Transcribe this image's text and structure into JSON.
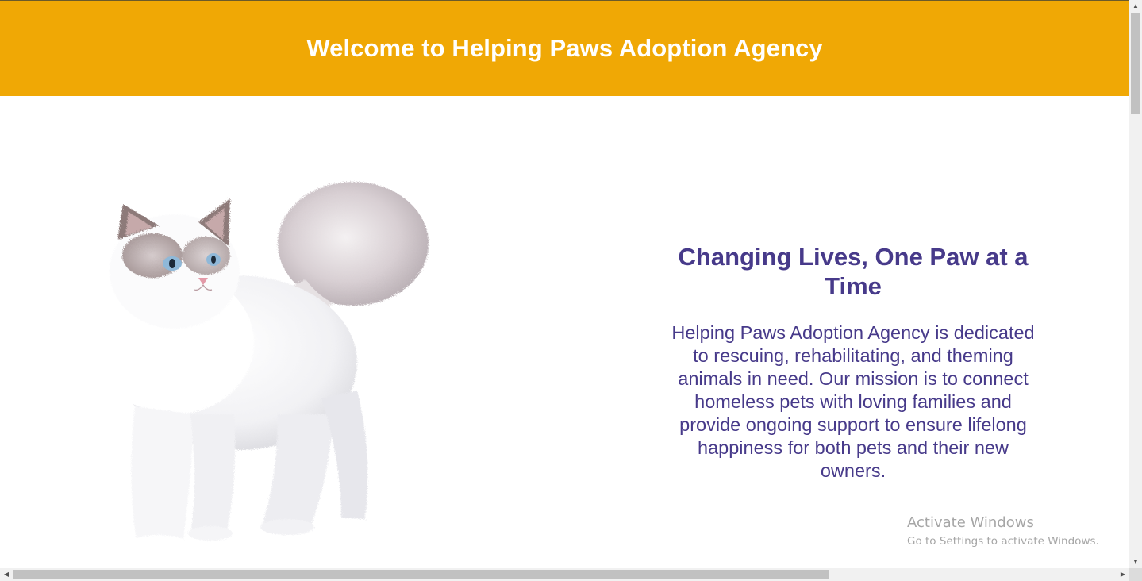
{
  "header": {
    "title": "Welcome to Helping Paws Adoption Agency"
  },
  "hero": {
    "title": "Changing Lives, One Paw at a Time",
    "body": "Helping Paws Adoption Agency is dedicated to rescuing, rehabilitating, and theming animals in need. Our mission is to connect homeless pets with loving families and provide ongoing support to ensure lifelong happiness for both pets and their new owners.",
    "image_icon": "white-fluffy-cat-image"
  },
  "watermark": {
    "title": "Activate Windows",
    "subtitle": "Go to Settings to activate Windows."
  },
  "scrollbars": {
    "up_icon": "▲",
    "down_icon": "▼",
    "left_icon": "◀",
    "right_icon": "▶"
  },
  "colors": {
    "header_bg": "#f0a805",
    "header_text": "#ffffff",
    "hero_text": "#473a8a",
    "watermark_text": "#a6a6a6"
  }
}
